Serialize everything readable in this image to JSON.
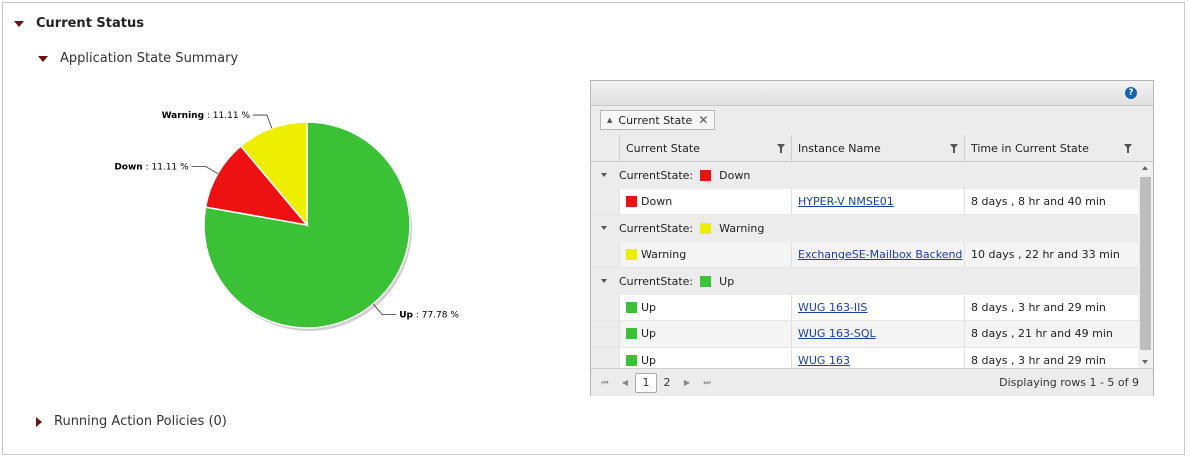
{
  "sections": {
    "current_status": "Current Status",
    "app_state_summary": "Application State Summary",
    "running_action_policies": "Running Action Policies (0)"
  },
  "chart_data": {
    "type": "pie",
    "slices": [
      {
        "label": "Up",
        "value": 77.78,
        "display": "77.78 %",
        "color": "#3bc135"
      },
      {
        "label": "Down",
        "value": 11.11,
        "display": "11.11 %",
        "color": "#ee1111"
      },
      {
        "label": "Warning",
        "value": 11.11,
        "display": "11.11 %",
        "color": "#eeee00"
      }
    ],
    "legend": "none",
    "label_style": "callout"
  },
  "grid": {
    "help_icon": "?",
    "group_chip": "Current State",
    "columns": [
      "Current State",
      "Instance Name",
      "Time in Current State"
    ],
    "group_prefix": "CurrentState:",
    "groups": [
      {
        "state": "Down",
        "color": "#ee1111",
        "rows": [
          {
            "state": "Down",
            "instance": "HYPER-V NMSE01",
            "time": "8 days , 8 hr and 40 min"
          }
        ]
      },
      {
        "state": "Warning",
        "color": "#eeee00",
        "rows": [
          {
            "state": "Warning",
            "instance": "ExchangeSE-Mailbox Backend",
            "time": "10 days , 22 hr and 33 min"
          }
        ]
      },
      {
        "state": "Up",
        "color": "#3bc135",
        "rows": [
          {
            "state": "Up",
            "instance": "WUG 163-IIS",
            "time": "8 days , 3 hr and 29 min"
          },
          {
            "state": "Up",
            "instance": "WUG 163-SQL",
            "time": "8 days , 21 hr and 49 min"
          },
          {
            "state": "Up",
            "instance": "WUG 163",
            "time": "8 days , 3 hr and 29 min"
          }
        ]
      }
    ],
    "pager": {
      "first": "⏮",
      "prev": "◀",
      "next": "▶",
      "last": "⏭",
      "pages": [
        "1",
        "2"
      ],
      "current_page": "1",
      "info": "Displaying rows 1 - 5 of 9"
    }
  }
}
